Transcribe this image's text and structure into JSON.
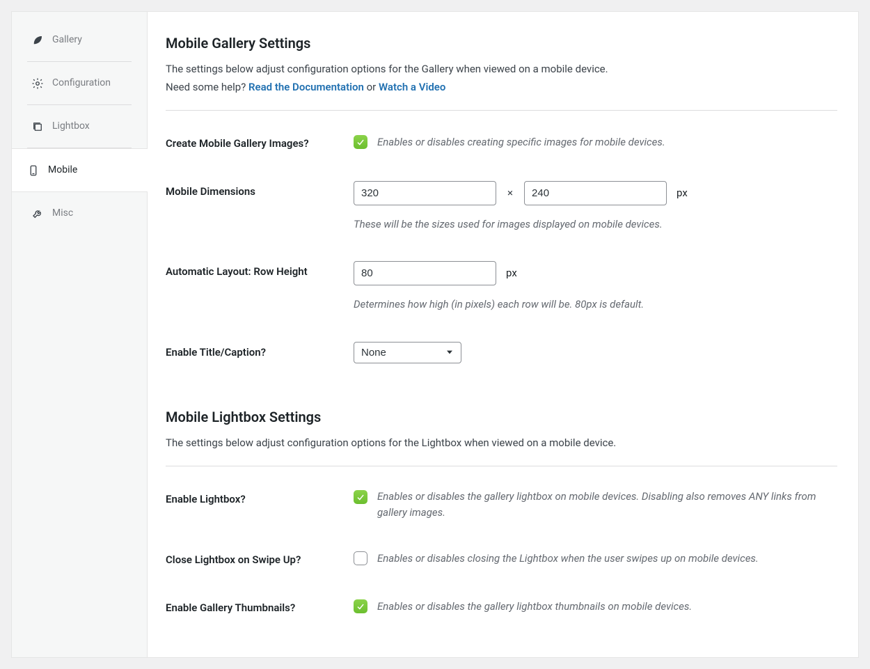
{
  "sidebar": {
    "items": [
      {
        "label": "Gallery"
      },
      {
        "label": "Configuration"
      },
      {
        "label": "Lightbox"
      },
      {
        "label": "Mobile"
      },
      {
        "label": "Misc"
      }
    ]
  },
  "s1": {
    "title": "Mobile Gallery Settings",
    "intro1": "The settings below adjust configuration options for the Gallery when viewed on a mobile device.",
    "help_prefix": "Need some help? ",
    "link_docs": "Read the Documentation",
    "help_mid": " or ",
    "link_video": "Watch a Video",
    "r1": {
      "label": "Create Mobile Gallery Images?",
      "desc": "Enables or disables creating specific images for mobile devices."
    },
    "r2": {
      "label": "Mobile Dimensions",
      "w": "320",
      "h": "240",
      "x": "×",
      "unit": "px",
      "help": "These will be the sizes used for images displayed on mobile devices."
    },
    "r3": {
      "label": "Automatic Layout: Row Height",
      "val": "80",
      "unit": "px",
      "help": "Determines how high (in pixels) each row will be. 80px is default."
    },
    "r4": {
      "label": "Enable Title/Caption?",
      "selected": "None"
    }
  },
  "s2": {
    "title": "Mobile Lightbox Settings",
    "intro": "The settings below adjust configuration options for the Lightbox when viewed on a mobile device.",
    "r1": {
      "label": "Enable Lightbox?",
      "desc": "Enables or disables the gallery lightbox on mobile devices. Disabling also removes ANY links from gallery images."
    },
    "r2": {
      "label": "Close Lightbox on Swipe Up?",
      "desc": "Enables or disables closing the Lightbox when the user swipes up on mobile devices."
    },
    "r3": {
      "label": "Enable Gallery Thumbnails?",
      "desc": "Enables or disables the gallery lightbox thumbnails on mobile devices."
    }
  }
}
